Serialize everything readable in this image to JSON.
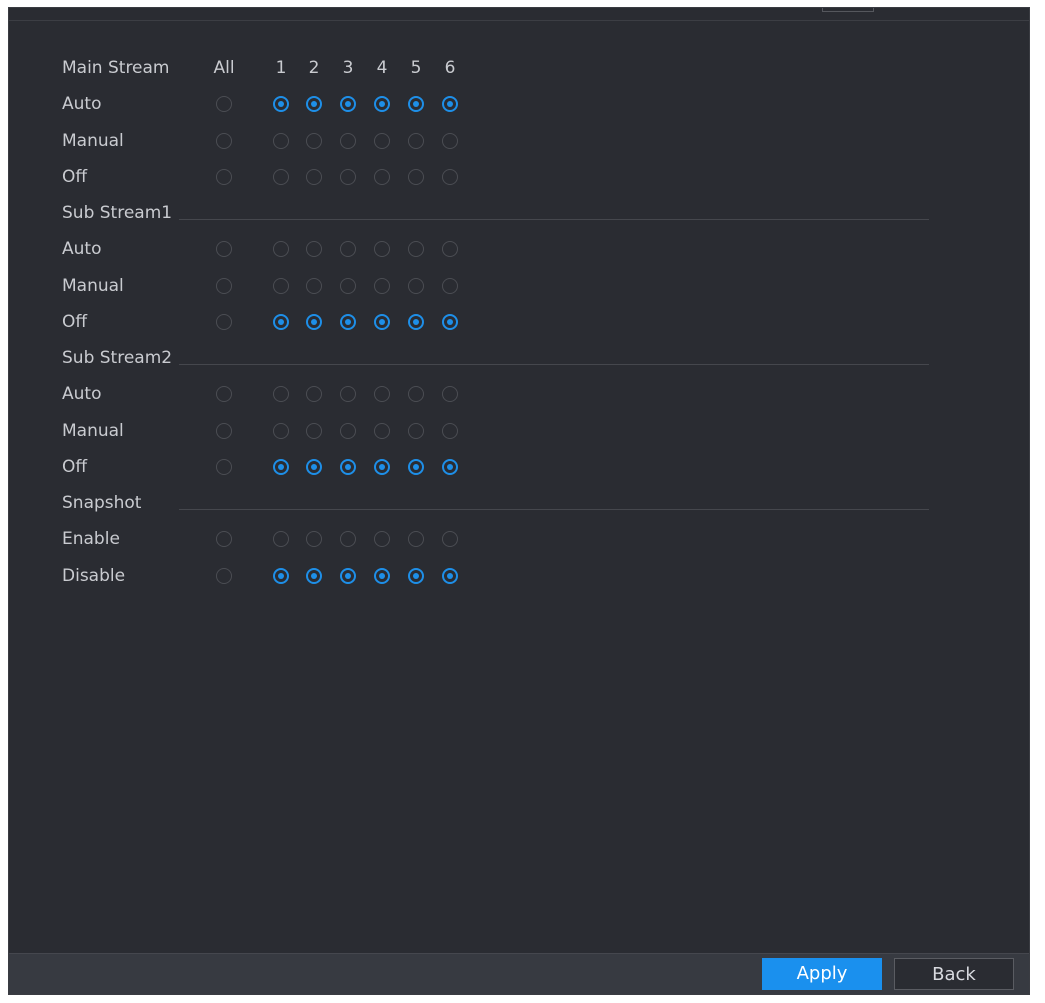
{
  "header": {
    "columns": [
      "All",
      "1",
      "2",
      "3",
      "4",
      "5",
      "6"
    ]
  },
  "sections": [
    {
      "title": "Main Stream",
      "options": [
        {
          "label": "Auto",
          "all": false,
          "channels": [
            true,
            true,
            true,
            true,
            true,
            true
          ]
        },
        {
          "label": "Manual",
          "all": false,
          "channels": [
            false,
            false,
            false,
            false,
            false,
            false
          ]
        },
        {
          "label": "Off",
          "all": false,
          "channels": [
            false,
            false,
            false,
            false,
            false,
            false
          ]
        }
      ]
    },
    {
      "title": "Sub Stream1",
      "options": [
        {
          "label": "Auto",
          "all": false,
          "channels": [
            false,
            false,
            false,
            false,
            false,
            false
          ]
        },
        {
          "label": "Manual",
          "all": false,
          "channels": [
            false,
            false,
            false,
            false,
            false,
            false
          ]
        },
        {
          "label": "Off",
          "all": false,
          "channels": [
            true,
            true,
            true,
            true,
            true,
            true
          ]
        }
      ]
    },
    {
      "title": "Sub Stream2",
      "options": [
        {
          "label": "Auto",
          "all": false,
          "channels": [
            false,
            false,
            false,
            false,
            false,
            false
          ]
        },
        {
          "label": "Manual",
          "all": false,
          "channels": [
            false,
            false,
            false,
            false,
            false,
            false
          ]
        },
        {
          "label": "Off",
          "all": false,
          "channels": [
            true,
            true,
            true,
            true,
            true,
            true
          ]
        }
      ]
    },
    {
      "title": "Snapshot",
      "options": [
        {
          "label": "Enable",
          "all": false,
          "channels": [
            false,
            false,
            false,
            false,
            false,
            false
          ]
        },
        {
          "label": "Disable",
          "all": false,
          "channels": [
            true,
            true,
            true,
            true,
            true,
            true
          ]
        }
      ]
    }
  ],
  "footer": {
    "apply_label": "Apply",
    "back_label": "Back"
  },
  "colors": {
    "panel": "#2a2c32",
    "accent": "#1e8fe8",
    "text": "#c9cbd0"
  }
}
